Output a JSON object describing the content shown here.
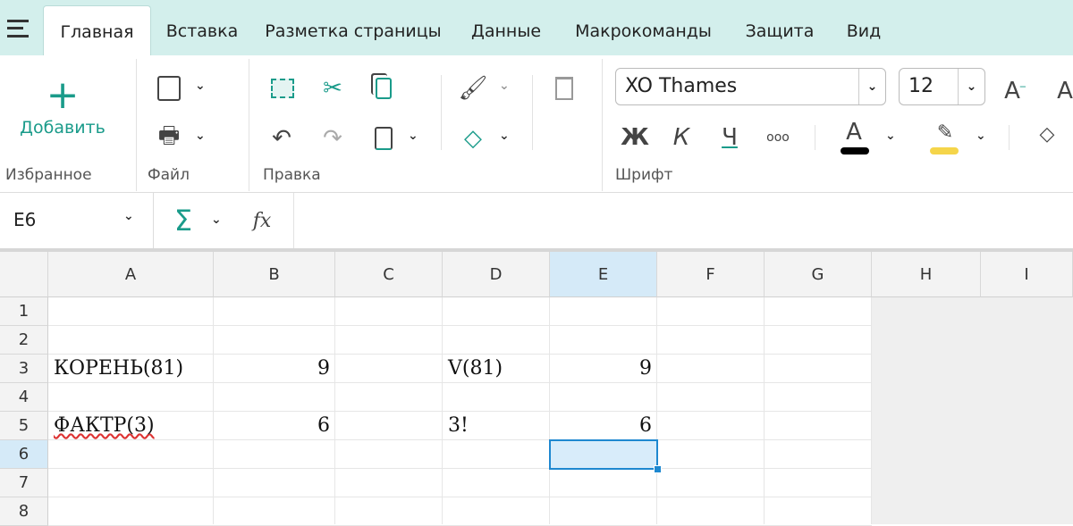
{
  "tabs": [
    {
      "label": "Главная",
      "active": true
    },
    {
      "label": "Вставка"
    },
    {
      "label": "Разметка страницы"
    },
    {
      "label": "Данные"
    },
    {
      "label": "Макрокоманды"
    },
    {
      "label": "Защита"
    },
    {
      "label": "Вид"
    }
  ],
  "ribbon": {
    "favorites": {
      "add_label": "Добавить",
      "group_label": "Избранное"
    },
    "file": {
      "group_label": "Файл"
    },
    "edit": {
      "group_label": "Правка"
    },
    "font": {
      "group_label": "Шрифт",
      "font_name": "XO Thames",
      "font_size": "12",
      "bold": "Ж",
      "italic": "К",
      "underline": "Ч",
      "more": "ooo",
      "font_color_letter": "A",
      "font_color": "#000000",
      "highlight_color": "#f5d54a"
    }
  },
  "formula_bar": {
    "name_box": "E6",
    "formula": ""
  },
  "colors": {
    "accent": "#1a9b8a",
    "selection": "#1e88d0"
  },
  "grid": {
    "columns": [
      "A",
      "B",
      "C",
      "D",
      "E",
      "F",
      "G",
      "H",
      "I"
    ],
    "rows": [
      "1",
      "2",
      "3",
      "4",
      "5",
      "6",
      "7",
      "8"
    ],
    "selected": "E6",
    "cells": {
      "A3": "КОРЕНЬ(81)",
      "B3": "9",
      "D3": "V(81)",
      "E3": "9",
      "A5": "ФАКТР(3)",
      "B5": "6",
      "D5": "3!",
      "E5": "6"
    }
  }
}
